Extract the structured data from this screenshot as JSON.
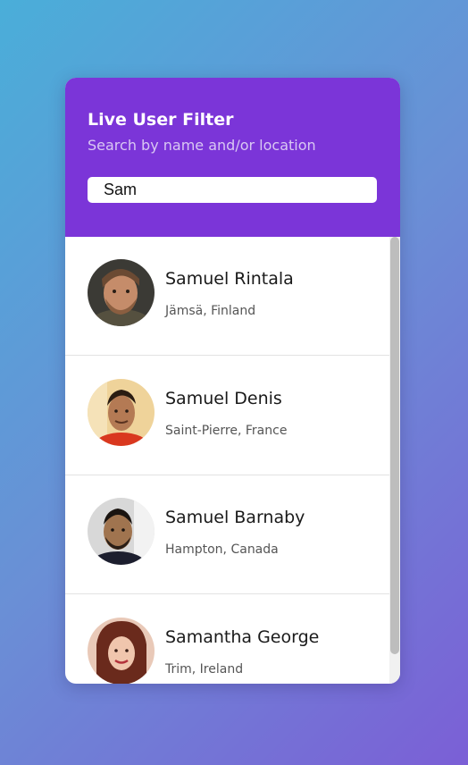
{
  "header": {
    "title": "Live User Filter",
    "subtitle": "Search by name and/or location"
  },
  "search": {
    "value": "Sam"
  },
  "users": [
    {
      "name": "Samuel Rintala",
      "location": "Jämsä, Finland"
    },
    {
      "name": "Samuel Denis",
      "location": "Saint-Pierre, France"
    },
    {
      "name": "Samuel Barnaby",
      "location": "Hampton, Canada"
    },
    {
      "name": "Samantha George",
      "location": "Trim, Ireland"
    }
  ],
  "colors": {
    "header_bg": "#7b35d8",
    "title": "#ffffff",
    "subtitle": "#d9c8f3",
    "scrollbar_thumb": "#bdbdbd"
  }
}
